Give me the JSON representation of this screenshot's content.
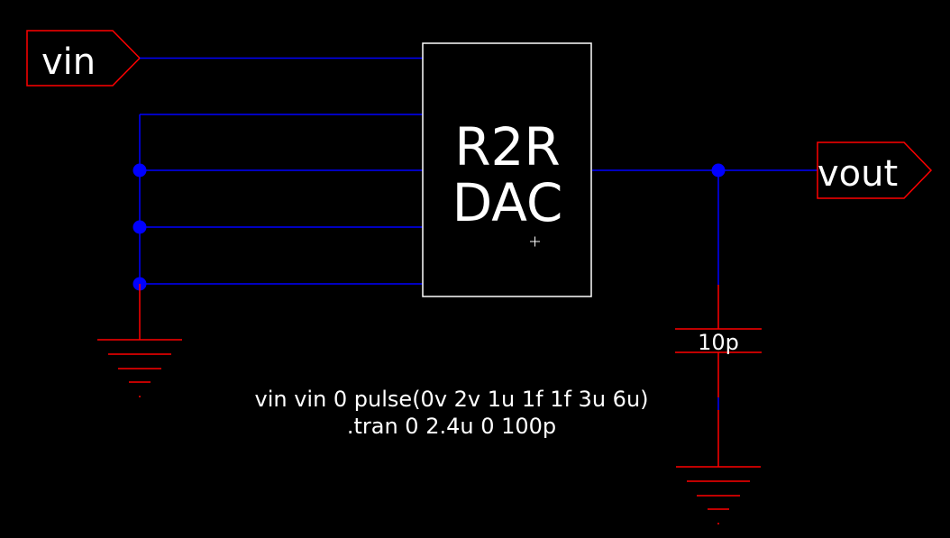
{
  "colors": {
    "background": "#000000",
    "wire": "#0000ff",
    "junction": "#0000ff",
    "pin_outline": "#ff0000",
    "component": "#ff0000",
    "block_outline": "#ffffff",
    "text": "#ffffff"
  },
  "ports": {
    "input": {
      "label": "vin"
    },
    "output": {
      "label": "vout"
    }
  },
  "block": {
    "line1": "R2R",
    "line2": "DAC"
  },
  "capacitor": {
    "value": "10p"
  },
  "directives": {
    "source": "vin vin 0 pulse(0v 2v 1u 1f 1f 3u 6u)",
    "analysis": ".tran 0 2.4u 0 100p"
  },
  "icons": {
    "ground": "ground-symbol-icon",
    "capacitor": "capacitor-icon",
    "crosshair": "crosshair-cursor-icon"
  }
}
